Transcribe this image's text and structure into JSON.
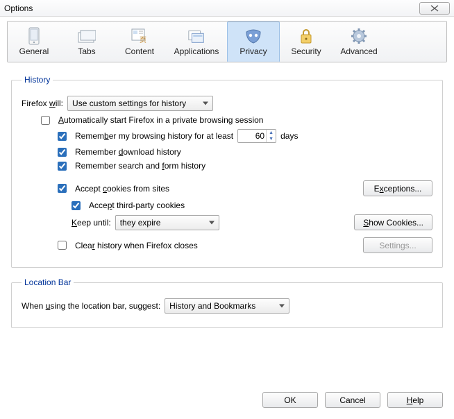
{
  "window": {
    "title": "Options"
  },
  "tabs": {
    "general": "General",
    "tabs": "Tabs",
    "content": "Content",
    "applications": "Applications",
    "privacy": "Privacy",
    "security": "Security",
    "advanced": "Advanced"
  },
  "history": {
    "legend": "History",
    "firefox_will_pre": "Firefox ",
    "firefox_will_u": "w",
    "firefox_will_post": "ill:",
    "firefox_will_value": "Use custom settings for history",
    "auto_private_pre": "A",
    "auto_private_post": "utomatically start Firefox in a private browsing session",
    "remember_browsing_pre": "Remem",
    "remember_browsing_u": "b",
    "remember_browsing_post": "er my browsing history for at least",
    "remember_browsing_days": "60",
    "remember_browsing_suffix": "days",
    "remember_download_pre": "Remember ",
    "remember_download_u": "d",
    "remember_download_post": "ownload history",
    "remember_form_pre": "Remember search and ",
    "remember_form_u": "f",
    "remember_form_post": "orm history",
    "accept_cookies_pre": "Accept ",
    "accept_cookies_u": "c",
    "accept_cookies_post": "ookies from sites",
    "exceptions_pre": "E",
    "exceptions_u": "x",
    "exceptions_post": "ceptions...",
    "accept_third_pre": "Acce",
    "accept_third_u": "p",
    "accept_third_post": "t third-party cookies",
    "keep_until_pre": "",
    "keep_until_u": "K",
    "keep_until_post": "eep until:",
    "keep_until_value": "they expire",
    "show_cookies_pre": "",
    "show_cookies_u": "S",
    "show_cookies_post": "how Cookies...",
    "clear_close_pre": "Clea",
    "clear_close_u": "r",
    "clear_close_post": " history when Firefox closes",
    "settings_label": "Settings..."
  },
  "locationbar": {
    "legend": "Location Bar",
    "suggest_pre": "When ",
    "suggest_u": "u",
    "suggest_post": "sing the location bar, suggest:",
    "suggest_value": "History and Bookmarks"
  },
  "buttons": {
    "ok": "OK",
    "cancel": "Cancel",
    "help_u": "H",
    "help_post": "elp"
  }
}
